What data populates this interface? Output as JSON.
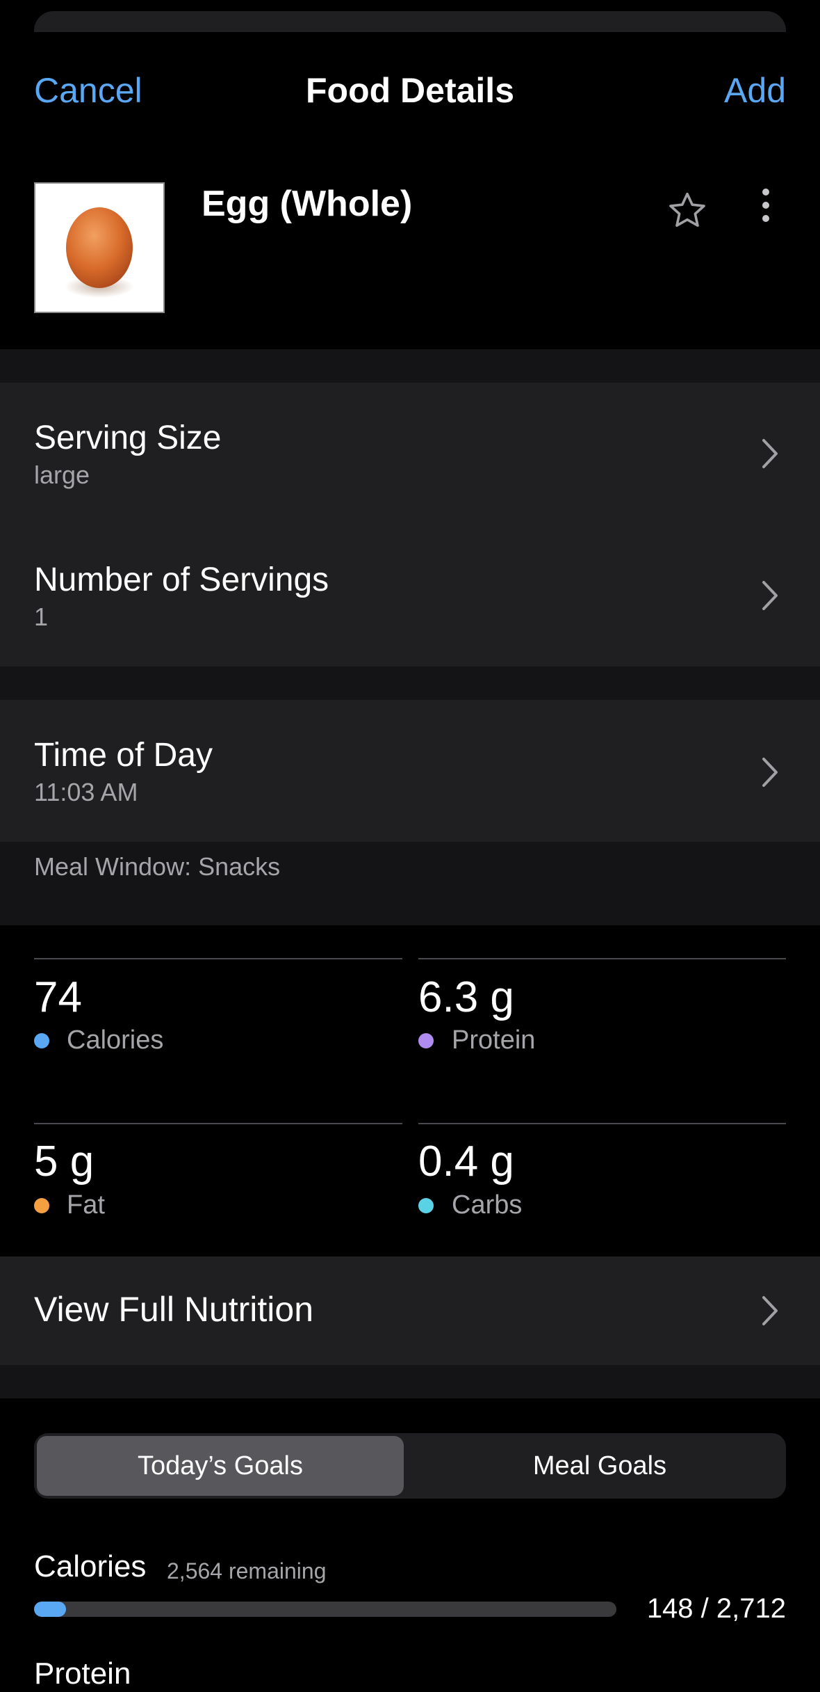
{
  "nav": {
    "cancel": "Cancel",
    "title": "Food Details",
    "add": "Add"
  },
  "food": {
    "name": "Egg (Whole)",
    "image": "egg-photo",
    "favorite_icon": "star-outline-icon",
    "more_icon": "vertical-ellipsis-icon"
  },
  "serving": {
    "title": "Serving Size",
    "value": "large"
  },
  "servings_count": {
    "title": "Number of Servings",
    "value": "1"
  },
  "time": {
    "title": "Time of Day",
    "value": "11:03 AM"
  },
  "meal_window": "Meal Window: Snacks",
  "stats": [
    {
      "value": "74",
      "label": "Calories",
      "color": "#5aa8f3"
    },
    {
      "value": "6.3 g",
      "label": "Protein",
      "color": "#b18cf0"
    },
    {
      "value": "5 g",
      "label": "Fat",
      "color": "#f5a040"
    },
    {
      "value": "0.4 g",
      "label": "Carbs",
      "color": "#5ad2e6"
    }
  ],
  "view_full": "View Full Nutrition",
  "tabs": {
    "selected": "Today’s Goals",
    "other": "Meal Goals"
  },
  "goals": {
    "label": "Calories",
    "remaining": "2,564 remaining",
    "ratio": "148 / 2,712",
    "progress": 0.055,
    "progress_color": "#5aa8f3"
  },
  "partial_label": "Protein"
}
